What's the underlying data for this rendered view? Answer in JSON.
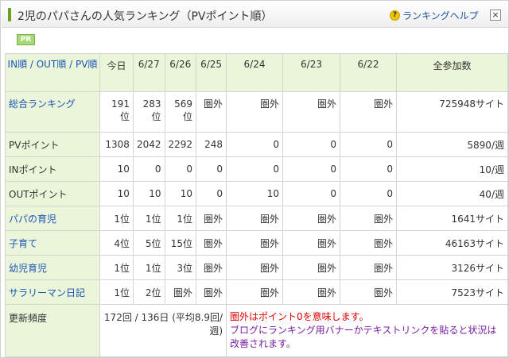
{
  "header": {
    "title": "2児のパパさんの人気ランキング（PVポイント順）",
    "help_label": "ランキングヘルプ"
  },
  "pr_badge": "PR",
  "columns": [
    "IN順 / OUT順 / PV順",
    "今日",
    "6/27",
    "6/26",
    "6/25",
    "6/24",
    "6/23",
    "6/22",
    "全参加数"
  ],
  "rows": [
    {
      "label": "総合ランキング",
      "link": true,
      "values": [
        "191位",
        "283位",
        "569位",
        "圏外",
        "圏外",
        "圏外",
        "圏外"
      ],
      "total": "725948サイト"
    },
    {
      "label": "PVポイント",
      "link": false,
      "values": [
        "1308",
        "2042",
        "2292",
        "248",
        "0",
        "0",
        "0"
      ],
      "total": "5890/週"
    },
    {
      "label": "INポイント",
      "link": false,
      "values": [
        "10",
        "0",
        "0",
        "0",
        "0",
        "0",
        "0"
      ],
      "total": "10/週"
    },
    {
      "label": "OUTポイント",
      "link": false,
      "values": [
        "10",
        "10",
        "10",
        "0",
        "10",
        "0",
        "0"
      ],
      "total": "40/週"
    },
    {
      "label": "パパの育児",
      "link": true,
      "values": [
        "1位",
        "1位",
        "1位",
        "圏外",
        "圏外",
        "圏外",
        "圏外"
      ],
      "total": "1641サイト"
    },
    {
      "label": "子育て",
      "link": true,
      "values": [
        "4位",
        "5位",
        "15位",
        "圏外",
        "圏外",
        "圏外",
        "圏外"
      ],
      "total": "46163サイト"
    },
    {
      "label": "幼児育児",
      "link": true,
      "values": [
        "1位",
        "1位",
        "3位",
        "圏外",
        "圏外",
        "圏外",
        "圏外"
      ],
      "total": "3126サイト"
    },
    {
      "label": "サラリーマン日記",
      "link": true,
      "values": [
        "1位",
        "2位",
        "圏外",
        "圏外",
        "圏外",
        "圏外",
        "圏外"
      ],
      "total": "7523サイト"
    }
  ],
  "update": {
    "label": "更新頻度",
    "value": "172回 / 136日 (平均8.9回/週)",
    "note_red": "圏外はポイント0を意味します。",
    "note_purple": "ブログにランキング用バナーかテキストリンクを貼ると状況は改善されます。"
  },
  "colors": {
    "accent_green": "#6aa121",
    "header_bg": "#eaf5d9",
    "link_blue": "#1a55b5",
    "note_red": "#e00000",
    "note_purple": "#7a1fa2"
  }
}
